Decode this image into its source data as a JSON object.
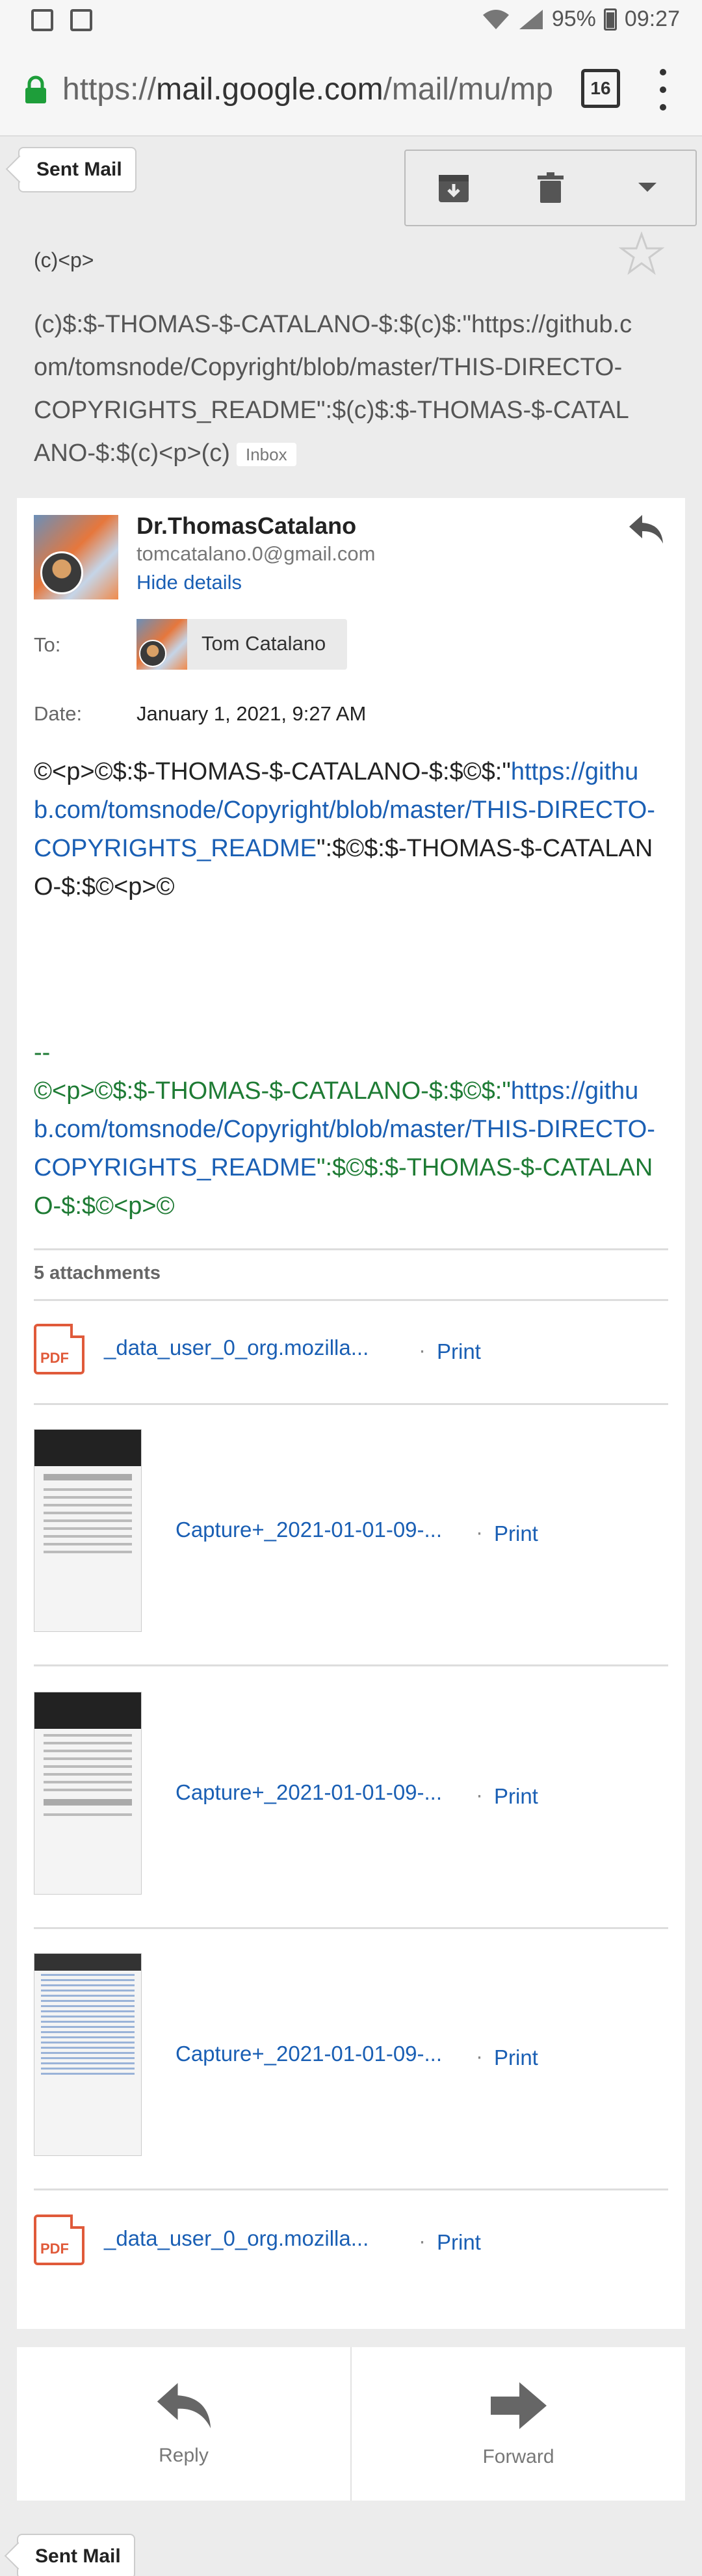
{
  "status_bar": {
    "battery": "95%",
    "time": "09:27"
  },
  "browser": {
    "url_prefix": "https://",
    "url_host": "mail.google.com",
    "url_path": "/mail/mu/mp",
    "tab_count": "16"
  },
  "nav": {
    "sent_mail": "Sent Mail"
  },
  "subject_small": "(c)<p>",
  "subject": "(c)$:$-THOMAS-$-CATALANO-$:$(c)$:\"https://github.com/tomsnode/Copyright/blob/master/THIS-DIRECTO-COPYRIGHTS_README\":$(c)$:$-THOMAS-$-CATALANO-$:$(c)<p>(c)",
  "inbox_label": "Inbox",
  "message": {
    "sender_name": "Dr.ThomasCatalano",
    "sender_email": "tomcatalano.0@gmail.com",
    "hide_details": "Hide details",
    "to_label": "To:",
    "to_name": "Tom Catalano",
    "date_label": "Date:",
    "date_value": "January 1, 2021, 9:27 AM",
    "body_prefix": "©<p>©$:$-THOMAS-$-CATALANO-$:$©$:\"",
    "body_link": "https://github.com/tomsnode/Copyright/blob/master/THIS-DIRECTO-COPYRIGHTS_README",
    "body_suffix": "\":$©$:$-THOMAS-$-CATALANO-$:$©<p>©",
    "sig_dash": "--",
    "sig_prefix": "©<p>©$:$-THOMAS-$-CATALANO-$:$©$:\"",
    "sig_link": "https://github.com/tomsnode/Copyright/blob/master/THIS-DIRECTO-COPYRIGHTS_README",
    "sig_suffix": "\":$©$:$-THOMAS-$-CATALANO-$:$©<p>©"
  },
  "attachments": {
    "count_label": "5 attachments",
    "dot": "·",
    "print_label": "Print",
    "items": [
      {
        "name": "_data_user_0_org.mozilla...",
        "kind": "pdf"
      },
      {
        "name": "Capture+_2021-01-01-09-...",
        "kind": "image"
      },
      {
        "name": "Capture+_2021-01-01-09-...",
        "kind": "image"
      },
      {
        "name": "Capture+_2021-01-01-09-...",
        "kind": "image"
      },
      {
        "name": "_data_user_0_org.mozilla...",
        "kind": "pdf"
      }
    ],
    "pdf_icon_text": "PDF"
  },
  "actions": {
    "reply": "Reply",
    "forward": "Forward"
  },
  "colors": {
    "link": "#1a5fb4",
    "signature": "#1e7b34",
    "pdf": "#e05a3a"
  }
}
